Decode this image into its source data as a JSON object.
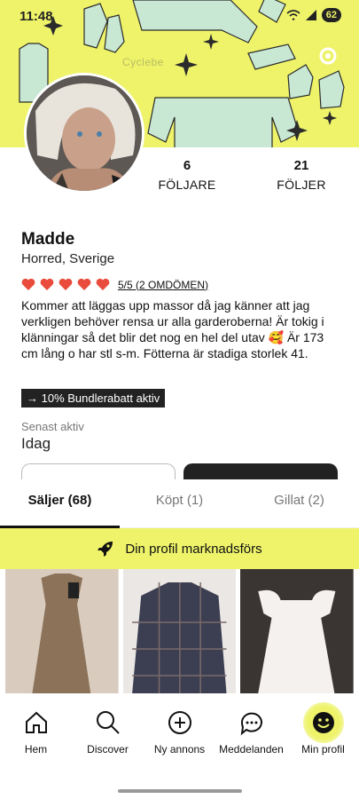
{
  "status": {
    "time": "11:48",
    "battery": "62"
  },
  "banner": {
    "caption": "Cyclebe"
  },
  "profile": {
    "name": "Madde",
    "location": "Horred, Sverige",
    "followers": {
      "count": "6",
      "label": "FÖLJARE"
    },
    "following": {
      "count": "21",
      "label": "FÖLJER"
    },
    "rating_text": "5/5 (2 OMDÖMEN)",
    "rating_value": 5,
    "bio": "Kommer att läggas upp massor då jag känner att jag verkligen behöver rensa ur alla garderoberna! Är tokig i klänningar så det blir det nog en hel del utav 🥰 Är 173 cm lång o har stl s-m. Fötterna är stadiga storlek 41.",
    "bundle_badge": "→ 10% Bundlerabatt aktiv",
    "last_active_label": "Senast aktiv",
    "last_active_value": "Idag"
  },
  "tabs": [
    {
      "label": "Säljer (68)",
      "active": true
    },
    {
      "label": "Köpt (1)",
      "active": false
    },
    {
      "label": "Gillat (2)",
      "active": false
    }
  ],
  "promo": {
    "label": "Din profil marknadsförs"
  },
  "items": [
    {
      "icon": "brown-dress-photo"
    },
    {
      "icon": "checked-shirt-photo"
    },
    {
      "icon": "white-dress-photo"
    }
  ],
  "nav": [
    {
      "label": "Hem",
      "icon": "home-icon"
    },
    {
      "label": "Discover",
      "icon": "search-icon"
    },
    {
      "label": "Ny annons",
      "icon": "plus-circle-icon"
    },
    {
      "label": "Meddelanden",
      "icon": "chat-icon"
    },
    {
      "label": "Min profil",
      "icon": "smiley-icon",
      "active": true
    }
  ],
  "colors": {
    "accent": "#eef36a",
    "hearts": "#e94b3c",
    "dark": "#222222"
  }
}
